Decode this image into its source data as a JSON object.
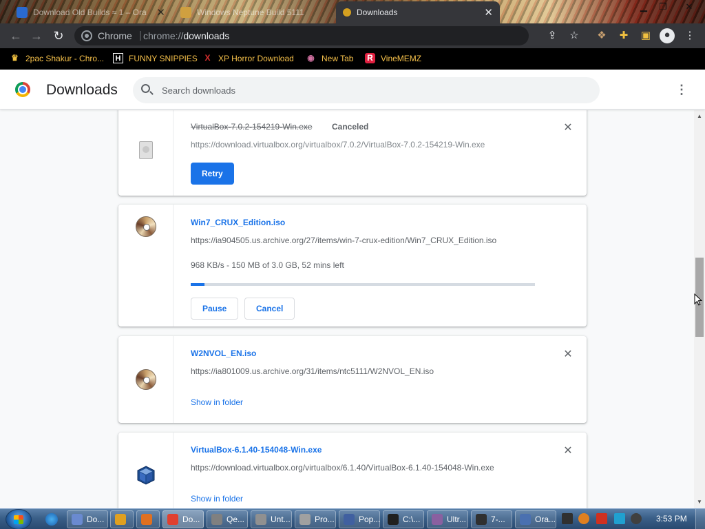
{
  "tabs": [
    {
      "title": "Download Old Builds ≈ 1 – Ora",
      "active": false,
      "favicon_color": "#2a6ad0"
    },
    {
      "title": "Windows Neptune Build 5111",
      "active": false,
      "favicon_color": "#d0a040"
    },
    {
      "title": "Downloads",
      "active": true,
      "favicon_color": "#d4a020"
    }
  ],
  "toolbar": {
    "back_icon": "back-arrow-icon",
    "forward_icon": "forward-arrow-icon",
    "reload_icon": "reload-icon",
    "omnibox_site": "Chrome",
    "omnibox_separator": "|",
    "omnibox_url_scheme": "chrome://",
    "omnibox_url_path": "downloads"
  },
  "bookmarks": [
    {
      "label": "2pac Shakur - Chro...",
      "icon": "tupac-icon",
      "icon_glyph": "♛",
      "color": "#f0c040"
    },
    {
      "label": "FUNNY SNIPPIES",
      "icon": "h-icon",
      "icon_glyph": "H",
      "color": "#ffffff"
    },
    {
      "label": "XP Horror Download",
      "icon": "x-icon",
      "icon_glyph": "X",
      "color": "#e03030"
    },
    {
      "label": "New Tab",
      "icon": "globe-icon",
      "icon_glyph": "◉",
      "color": "#d070a0"
    },
    {
      "label": "VineMEMZ",
      "icon": "r-icon",
      "icon_glyph": "R",
      "color": "#e02040"
    }
  ],
  "downloads_page": {
    "title": "Downloads",
    "search_placeholder": "Search downloads",
    "menu_icon": "more-vert-icon"
  },
  "downloads": [
    {
      "file_name": "VirtualBox-7.0.2-154219-Win.exe",
      "status_tag": "Canceled",
      "url": "https://download.virtualbox.org/virtualbox/7.0.2/VirtualBox-7.0.2-154219-Win.exe",
      "icon": "generic-file-icon",
      "button": "Retry",
      "close_glyph": "✕"
    },
    {
      "file_name": "Win7_CRUX_Edition.iso",
      "url": "https://ia904505.us.archive.org/27/items/win-7-crux-edition/Win7_CRUX_Edition.iso",
      "progress_text": "968 KB/s - 150 MB of 3.0 GB, 52 mins left",
      "progress_fraction": 0.04,
      "icon": "disc-image-icon",
      "buttons": [
        "Pause",
        "Cancel"
      ]
    },
    {
      "file_name": "W2NVOL_EN.iso",
      "url": "https://ia801009.us.archive.org/31/items/ntc5111/W2NVOL_EN.iso",
      "icon": "disc-image-icon",
      "link": "Show in folder",
      "close_glyph": "✕"
    },
    {
      "file_name": "VirtualBox-6.1.40-154048-Win.exe",
      "url": "https://download.virtualbox.org/virtualbox/6.1.40/VirtualBox-6.1.40-154048-Win.exe",
      "icon": "virtualbox-icon",
      "link": "Show in folder",
      "close_glyph": "✕"
    }
  ],
  "taskbar": {
    "pinned": [
      "internet-explorer-icon"
    ],
    "buttons": [
      {
        "label": "Do...",
        "icon": "explorer-icon",
        "active": false,
        "color": "#6a8ad0"
      },
      {
        "label": "",
        "icon": "media-player-icon",
        "active": false,
        "color": "#e0a020"
      },
      {
        "label": "",
        "icon": "paint-icon",
        "active": false,
        "color": "#e07020"
      },
      {
        "label": "Do...",
        "icon": "chrome-icon",
        "active": true,
        "color": "#e04030"
      },
      {
        "label": "Qe...",
        "icon": "qemu-icon",
        "active": false,
        "color": "#808080"
      },
      {
        "label": "Unt...",
        "icon": "untitled-icon",
        "active": false,
        "color": "#909090"
      },
      {
        "label": "Pro...",
        "icon": "properties-icon",
        "active": false,
        "color": "#a0a0a0"
      },
      {
        "label": "Pop...",
        "icon": "popup-icon",
        "active": false,
        "color": "#4060a0"
      },
      {
        "label": "C:\\...",
        "icon": "cmd-icon",
        "active": false,
        "color": "#202020"
      },
      {
        "label": "Ultr...",
        "icon": "ultraiso-icon",
        "active": false,
        "color": "#8a60a0"
      },
      {
        "label": "7-...",
        "icon": "7zip-icon",
        "active": false,
        "color": "#303030"
      },
      {
        "label": "Ora...",
        "icon": "virtualbox-icon",
        "active": false,
        "color": "#4a70b0"
      }
    ],
    "tray_icons": [
      "unknown-tray-icon",
      "tools-tray-icon",
      "flag-tray-icon",
      "monitor-tray-icon",
      "volume-tray-icon"
    ],
    "clock": "3:53 PM"
  }
}
